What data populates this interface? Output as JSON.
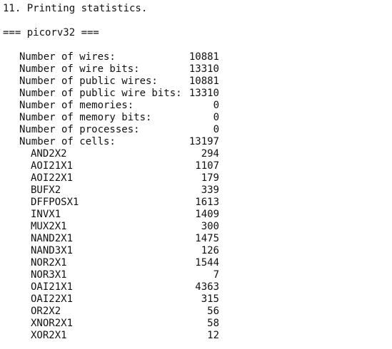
{
  "heading": "11. Printing statistics.",
  "module_header": "=== picorv32 ===",
  "stats": [
    {
      "label": "Number of wires:",
      "value": "10881"
    },
    {
      "label": "Number of wire bits:",
      "value": "13310"
    },
    {
      "label": "Number of public wires:",
      "value": "10881"
    },
    {
      "label": "Number of public wire bits:",
      "value": "13310"
    },
    {
      "label": "Number of memories:",
      "value": "0"
    },
    {
      "label": "Number of memory bits:",
      "value": "0"
    },
    {
      "label": "Number of processes:",
      "value": "0"
    },
    {
      "label": "Number of cells:",
      "value": "13197"
    }
  ],
  "cells": [
    {
      "label": "AND2X2",
      "value": "294"
    },
    {
      "label": "AOI21X1",
      "value": "1107"
    },
    {
      "label": "AOI22X1",
      "value": "179"
    },
    {
      "label": "BUFX2",
      "value": "339"
    },
    {
      "label": "DFFPOSX1",
      "value": "1613"
    },
    {
      "label": "INVX1",
      "value": "1409"
    },
    {
      "label": "MUX2X1",
      "value": "300"
    },
    {
      "label": "NAND2X1",
      "value": "1475"
    },
    {
      "label": "NAND3X1",
      "value": "126"
    },
    {
      "label": "NOR2X1",
      "value": "1544"
    },
    {
      "label": "NOR3X1",
      "value": "7"
    },
    {
      "label": "OAI21X1",
      "value": "4363"
    },
    {
      "label": "OAI22X1",
      "value": "315"
    },
    {
      "label": "OR2X2",
      "value": "56"
    },
    {
      "label": "XNOR2X1",
      "value": "58"
    },
    {
      "label": "XOR2X1",
      "value": "12"
    }
  ]
}
